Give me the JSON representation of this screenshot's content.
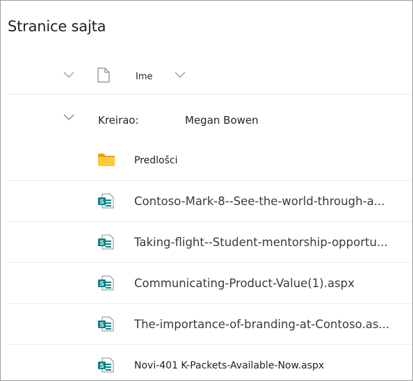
{
  "page": {
    "title": "Stranice sajta"
  },
  "header": {
    "name_column": "Ime"
  },
  "group": {
    "label": "Kreirao:",
    "value": "Megan Bowen"
  },
  "items": [
    {
      "type": "folder",
      "icon": "folder-icon",
      "name": "Predlošci"
    },
    {
      "type": "sitepage",
      "icon": "sharepoint-page-icon",
      "name": "Contoso-Mark-8--See-the-world-through-a..."
    },
    {
      "type": "sitepage",
      "icon": "sharepoint-page-icon",
      "name": "Taking-flight--Student-mentorship-opportu..."
    },
    {
      "type": "sitepage",
      "icon": "sharepoint-page-icon",
      "name": "Communicating-Product-Value(1).aspx"
    },
    {
      "type": "sitepage",
      "icon": "sharepoint-page-icon",
      "name": "The-importance-of-branding-at-Contoso.as..."
    },
    {
      "type": "sitepage",
      "icon": "sharepoint-page-icon",
      "name": "Novi-401 K-Packets-Available-Now.aspx"
    }
  ],
  "colors": {
    "sharepoint_teal": "#038387",
    "folder_yellow": "#FFB900",
    "divider": "#EDEBE9"
  }
}
